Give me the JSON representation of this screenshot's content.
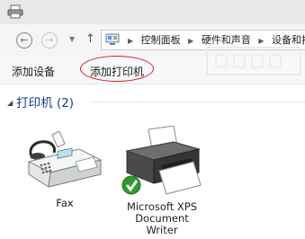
{
  "window": {
    "app_icon": "printer-icon"
  },
  "nav": {
    "back_icon": "back-arrow-icon",
    "forward_icon": "forward-arrow-icon",
    "recent_icon": "chevron-down-icon",
    "up_icon": "up-arrow-icon",
    "breadcrumb_icon": "control-panel-icon",
    "breadcrumbs": [
      "控制面板",
      "硬件和声音",
      "设备和打"
    ]
  },
  "commands": {
    "add_device": "添加设备",
    "add_printer": "添加打印机"
  },
  "group": {
    "title": "打印机",
    "count": "(2)"
  },
  "devices": [
    {
      "label_lines": [
        "Fax"
      ],
      "icon": "fax-icon",
      "default": false
    },
    {
      "label_lines": [
        "Microsoft XPS",
        "Document",
        "Writer"
      ],
      "icon": "printer-icon",
      "default": true
    }
  ],
  "colors": {
    "highlight": "#d42020",
    "group_title": "#1e3c8c",
    "default_badge": "#2d9a2d"
  }
}
